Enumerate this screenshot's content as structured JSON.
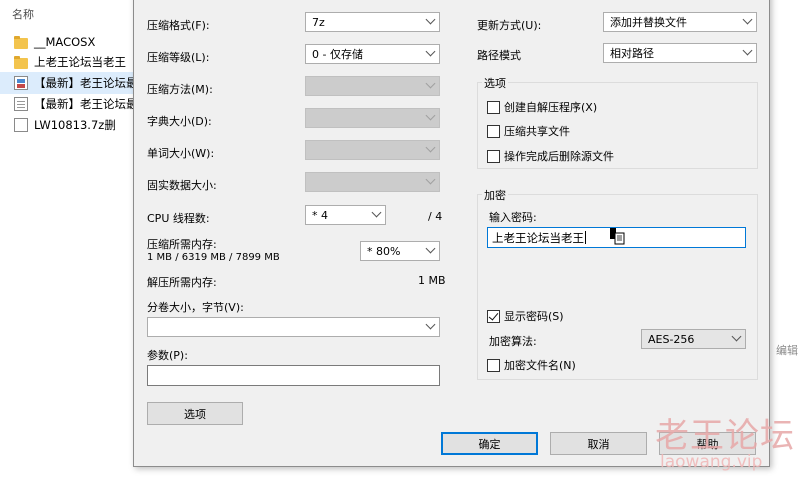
{
  "explorer": {
    "column_header": "名称",
    "files": [
      {
        "name": "__MACOSX",
        "icon": "folder-icon"
      },
      {
        "name": "上老王论坛当老王",
        "icon": "folder-icon"
      },
      {
        "name": "【最新】老王论坛最",
        "icon": "archive-icon"
      },
      {
        "name": "【最新】老王论坛最",
        "icon": "doc-icon"
      },
      {
        "name": "LW10813.7z删",
        "icon": "blank-icon"
      }
    ]
  },
  "left": {
    "format_label": "压缩格式(F):",
    "format_value": "7z",
    "level_label": "压缩等级(L):",
    "level_value": "0 - 仅存储",
    "method_label": "压缩方法(M):",
    "dict_label": "字典大小(D):",
    "word_label": "单词大小(W):",
    "solid_label": "固实数据大小:",
    "cpu_label": "CPU 线程数:",
    "cpu_value": "* 4",
    "cpu_max": "/ 4",
    "mem_comp_label": "压缩所需内存:",
    "mem_comp_detail": "1 MB / 6319 MB / 7899 MB",
    "mem_comp_value": "* 80%",
    "mem_decomp_label": "解压所需内存:",
    "mem_decomp_value": "1 MB",
    "volume_label": "分卷大小，字节(V):",
    "params_label": "参数(P):",
    "options_button": "选项"
  },
  "right": {
    "update_label": "更新方式(U):",
    "update_value": "添加并替换文件",
    "path_label": "路径模式",
    "path_value": "相对路径",
    "options_group": "选项",
    "opt_sfx": "创建自解压程序(X)",
    "opt_shared": "压缩共享文件",
    "opt_delete": "操作完成后删除源文件",
    "encrypt_group": "加密",
    "pw_label": "输入密码:",
    "pw_value": "上老王论坛当老王",
    "show_pw": "显示密码(S)",
    "method_label": "加密算法:",
    "method_value": "AES-256",
    "encrypt_names": "加密文件名(N)"
  },
  "buttons": {
    "ok": "确定",
    "cancel": "取消",
    "help": "帮助"
  },
  "edge": {
    "edit_label": "编辑"
  },
  "watermark": {
    "title": "老王论坛",
    "url": "laowang.vip"
  },
  "colors": {
    "accent": "#0078d7",
    "selected_row": "#dcecfc",
    "watermark": "#e7a8a8"
  }
}
